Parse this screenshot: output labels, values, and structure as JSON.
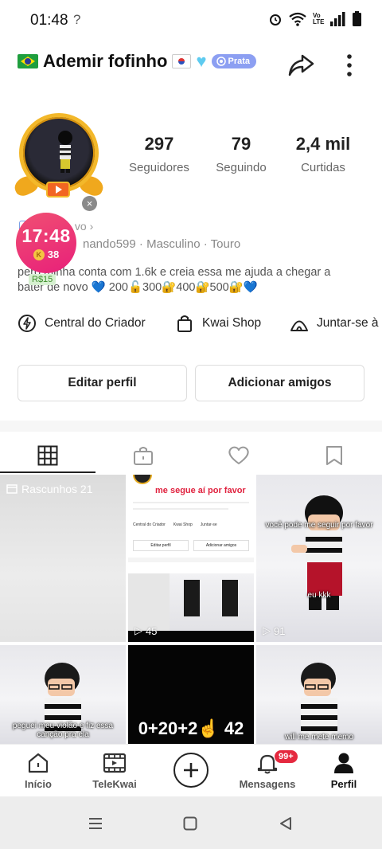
{
  "status_bar": {
    "time": "01:48",
    "alert": "?",
    "network": "Vo LTE"
  },
  "profile": {
    "name": "Ademir fofinho",
    "badge": "Prata",
    "stats": [
      {
        "value": "297",
        "label": "Seguidores"
      },
      {
        "value": "79",
        "label": "Seguindo"
      },
      {
        "value": "2,4 mil",
        "label": "Curtidas"
      }
    ],
    "level_text": "vo ›",
    "info": "nando599 · Masculino · Touro",
    "bio_line1": "pero minha conta com 1.6k e creia essa me ajuda a chegar a",
    "bio_line2": "bater de novo 💙 200🔓300🔐400🔐500🔐💙"
  },
  "overlay": {
    "timer": "17:48",
    "coins": "38",
    "money": "R$15",
    "close": "×"
  },
  "shortcuts": [
    {
      "icon": "lightning-icon",
      "label": "Central do Criador"
    },
    {
      "icon": "shopping-bag-icon",
      "label": "Kwai Shop"
    },
    {
      "icon": "tent-icon",
      "label": "Juntar-se à"
    }
  ],
  "buttons": {
    "edit": "Editar perfil",
    "add_friends": "Adicionar amigos"
  },
  "tabs": [
    "grid-icon",
    "lock-icon",
    "heart-icon",
    "bookmark-icon"
  ],
  "grid": {
    "draft_label": "Rascunhos 21",
    "cell2_title": "me segue aí por favor",
    "cell2_views": "45",
    "cell3_caption": "você pode me seguir por favor",
    "cell3_caption2": "eu kkk",
    "cell3_views": "91",
    "cell4_caption": "peguei meu violão e fiz essa canção pra ela",
    "cell5_text": "0+20+2☝ 42",
    "cell6_caption": "will me mete memo",
    "mini_screen": {
      "edit": "Editar perfil",
      "add": "Adicionar amigos",
      "shortcut1": "Central do Criador",
      "shortcut2": "Kwai Shop",
      "shortcut3": "Juntar-se"
    }
  },
  "nav": {
    "home": "Início",
    "telekwai": "TeleKwai",
    "messages": "Mensagens",
    "messages_badge": "99+",
    "profile": "Perfil"
  }
}
